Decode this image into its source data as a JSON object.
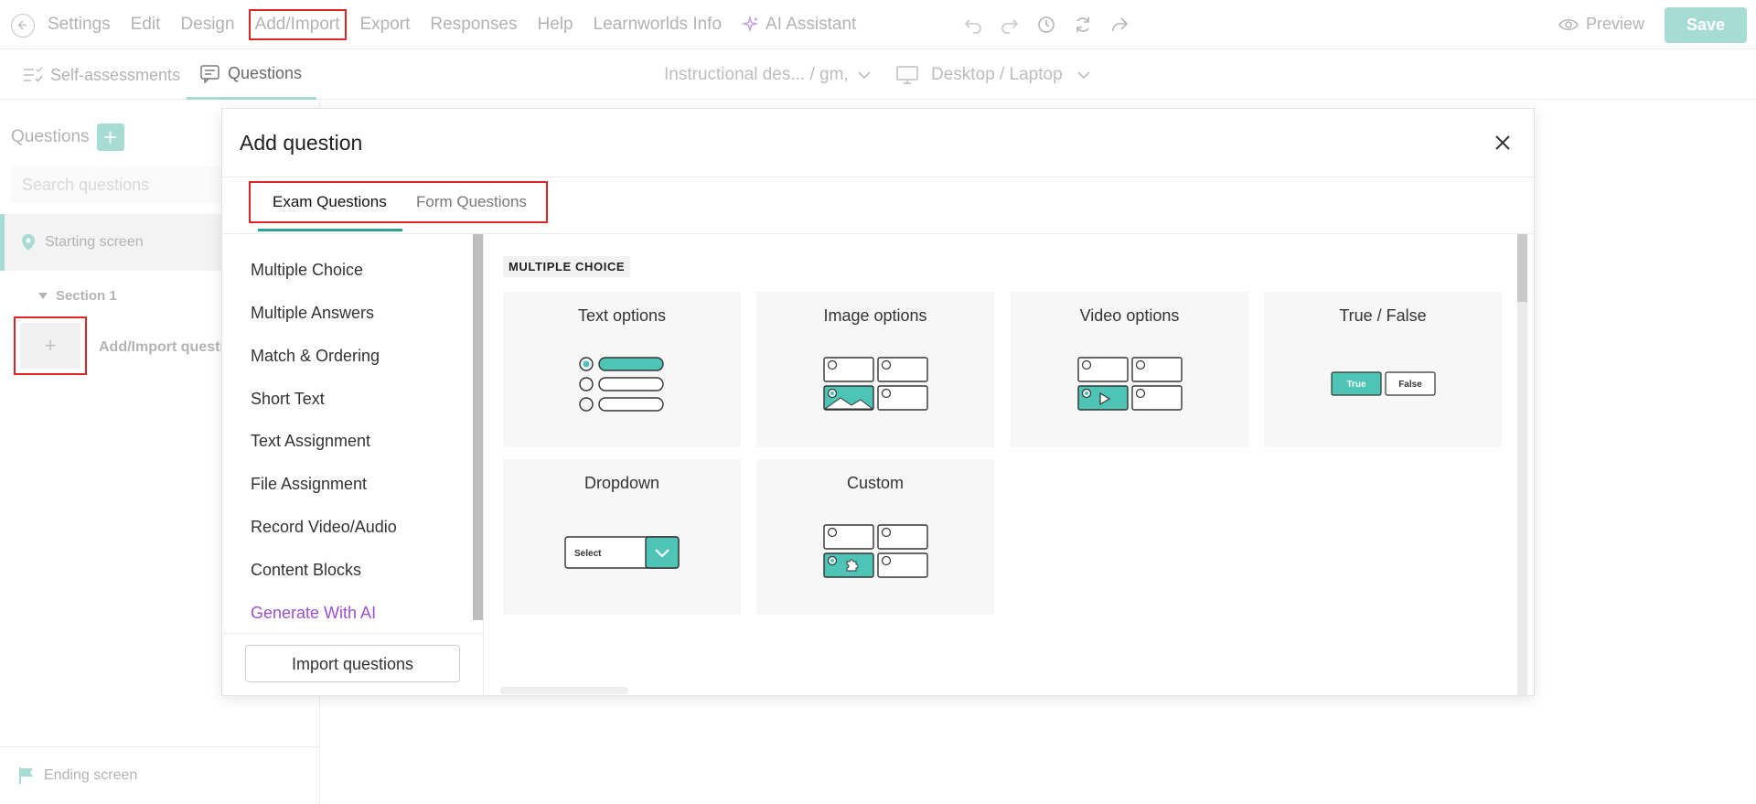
{
  "topbar": {
    "menu": [
      "Settings",
      "Edit",
      "Design",
      "Add/Import",
      "Export",
      "Responses",
      "Help",
      "Learnworlds Info"
    ],
    "ai_label": "AI Assistant",
    "preview_label": "Preview",
    "save_label": "Save"
  },
  "subbar": {
    "tab_self": "Self-assessments",
    "tab_questions": "Questions",
    "course_dropdown": "Instructional des... / gm,",
    "device_dropdown": "Desktop / Laptop"
  },
  "left": {
    "title": "Questions",
    "add_symbol": "+",
    "search_placeholder": "Search questions",
    "starting_screen": "Starting screen",
    "section": "Section 1",
    "add_box_symbol": "+",
    "add_label": "Add/Import questions",
    "ending_screen": "Ending screen"
  },
  "modal": {
    "title": "Add question",
    "tabs": [
      "Exam Questions",
      "Form Questions"
    ],
    "categories": [
      "Multiple Choice",
      "Multiple Answers",
      "Match & Ordering",
      "Short Text",
      "Text Assignment",
      "File Assignment",
      "Record Video/Audio",
      "Content Blocks",
      "Generate With AI"
    ],
    "import_label": "Import questions",
    "section_label": "MULTIPLE CHOICE",
    "cards": [
      "Text options",
      "Image options",
      "Video options",
      "True / False",
      "Dropdown",
      "Custom"
    ],
    "true_label": "True",
    "false_label": "False",
    "select_label": "Select"
  },
  "colors": {
    "accent": "#4dc4b6",
    "accent_light": "#a7dcd5",
    "highlight_border": "#e02424",
    "ai_purple": "#9b4fd6"
  }
}
